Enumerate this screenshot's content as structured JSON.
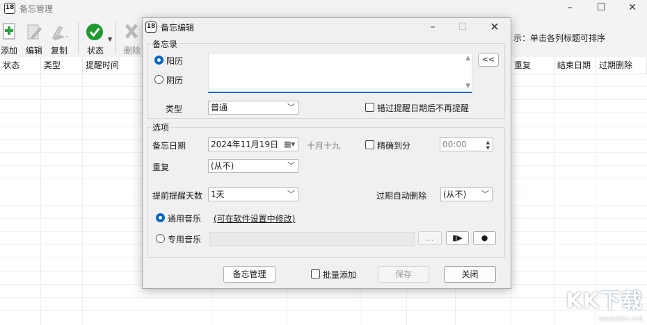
{
  "main_window": {
    "title": "备忘管理",
    "toolbar": {
      "add": "添加",
      "edit": "编辑",
      "copy": "复制",
      "status": "状态",
      "delete": "删除"
    },
    "hint": "示：单击各列标题可排序",
    "columns": [
      "状态",
      "类型",
      "提醒时间",
      "重复",
      "结束日期",
      "过期删除"
    ]
  },
  "dialog": {
    "title": "备忘编辑",
    "memo_group": {
      "title": "备忘录",
      "solar_label": "阳历",
      "lunar_label": "阴历",
      "collapse_button": "<<",
      "type_label": "类型",
      "type_value": "普通",
      "no_remind_after_checkbox": "错过提醒日期后不再提醒"
    },
    "options_group": {
      "title": "选项",
      "memo_date_label": "备忘日期",
      "memo_date_value": "2024年11月19日",
      "lunar_date": "十月十九",
      "precise_minute_checkbox": "精确到分",
      "time_value": "00:00",
      "repeat_label": "重复",
      "repeat_value": "(从不)",
      "advance_days_label": "提前提醒天数",
      "advance_days_value": "1天",
      "auto_delete_label": "过期自动删除",
      "auto_delete_value": "(从不)",
      "general_music_label": "通用音乐",
      "general_music_link": "(可在软件设置中修改)",
      "custom_music_label": "专用音乐",
      "browse_button": "..."
    },
    "footer": {
      "manage_button": "备忘管理",
      "batch_add_checkbox": "批量添加",
      "save_button": "保存",
      "close_button": "关闭"
    }
  },
  "watermark": {
    "brand": "KK下载",
    "url": "www.kkx.net"
  },
  "colors": {
    "accent": "#0067c0",
    "add_green": "#2ea043",
    "status_green": "#1f9a2e"
  }
}
